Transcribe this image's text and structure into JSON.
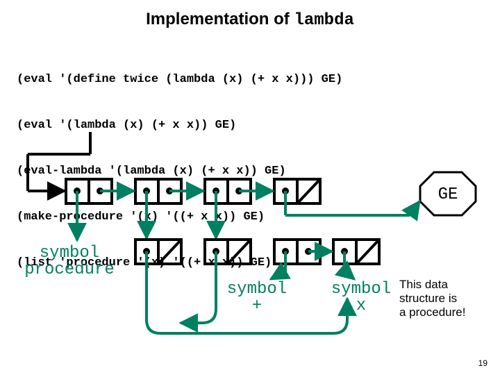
{
  "title_prefix": "Implementation of ",
  "title_keyword": "lambda",
  "code_lines": [
    "(eval '(define twice (lambda (x) (+ x x))) GE)",
    "(eval '(lambda (x) (+ x x)) GE)",
    "(eval-lambda '(lambda (x) (+ x x)) GE)",
    "(make-procedure '(x) '((+ x x)) GE)",
    "(list 'procedure '(x) '((+ x x)) GE)"
  ],
  "labels": {
    "ge": "GE",
    "symbol_procedure_l1": "symbol",
    "symbol_procedure_l2": "procedure",
    "symbol_plus_l1": "symbol",
    "symbol_plus_l2": "+",
    "symbol_x_l1": "symbol",
    "symbol_x_l2": "x"
  },
  "caption_l1": "This data",
  "caption_l2": "structure is",
  "caption_l3": "a procedure!",
  "page_number": "19"
}
